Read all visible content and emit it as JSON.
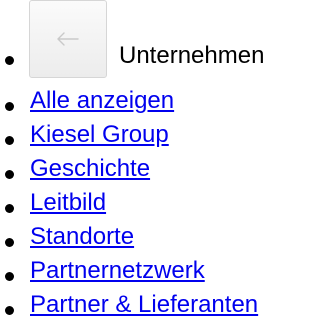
{
  "header": {
    "back_icon": "arrow-left-icon",
    "title": "Unternehmen"
  },
  "menu": {
    "items": [
      {
        "label": "Alle anzeigen"
      },
      {
        "label": "Kiesel Group"
      },
      {
        "label": "Geschichte"
      },
      {
        "label": "Leitbild"
      },
      {
        "label": "Standorte"
      },
      {
        "label": "Partnernetzwerk"
      },
      {
        "label": "Partner & Lieferanten"
      }
    ]
  },
  "colors": {
    "link": "#0000ee",
    "text": "#000000",
    "bullet": "#000000"
  }
}
